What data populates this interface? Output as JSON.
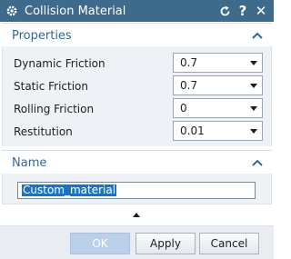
{
  "window": {
    "title": "Collision Material",
    "icons": {
      "app": "gear-icon",
      "reset": "reset-icon",
      "help": "help-icon",
      "close": "close-icon"
    }
  },
  "properties": {
    "header": "Properties",
    "rows": [
      {
        "label": "Dynamic Friction",
        "value": "0.7"
      },
      {
        "label": "Static Friction",
        "value": "0.7"
      },
      {
        "label": "Rolling Friction",
        "value": "0"
      },
      {
        "label": "Restitution",
        "value": "0.01"
      }
    ]
  },
  "name_section": {
    "header": "Name",
    "value": "Custom_material"
  },
  "buttons": {
    "ok": "OK",
    "apply": "Apply",
    "cancel": "Cancel"
  },
  "colors": {
    "titlebar": "#3e6b8b",
    "group_title": "#2d6aa3",
    "selection": "#1a73c9"
  }
}
